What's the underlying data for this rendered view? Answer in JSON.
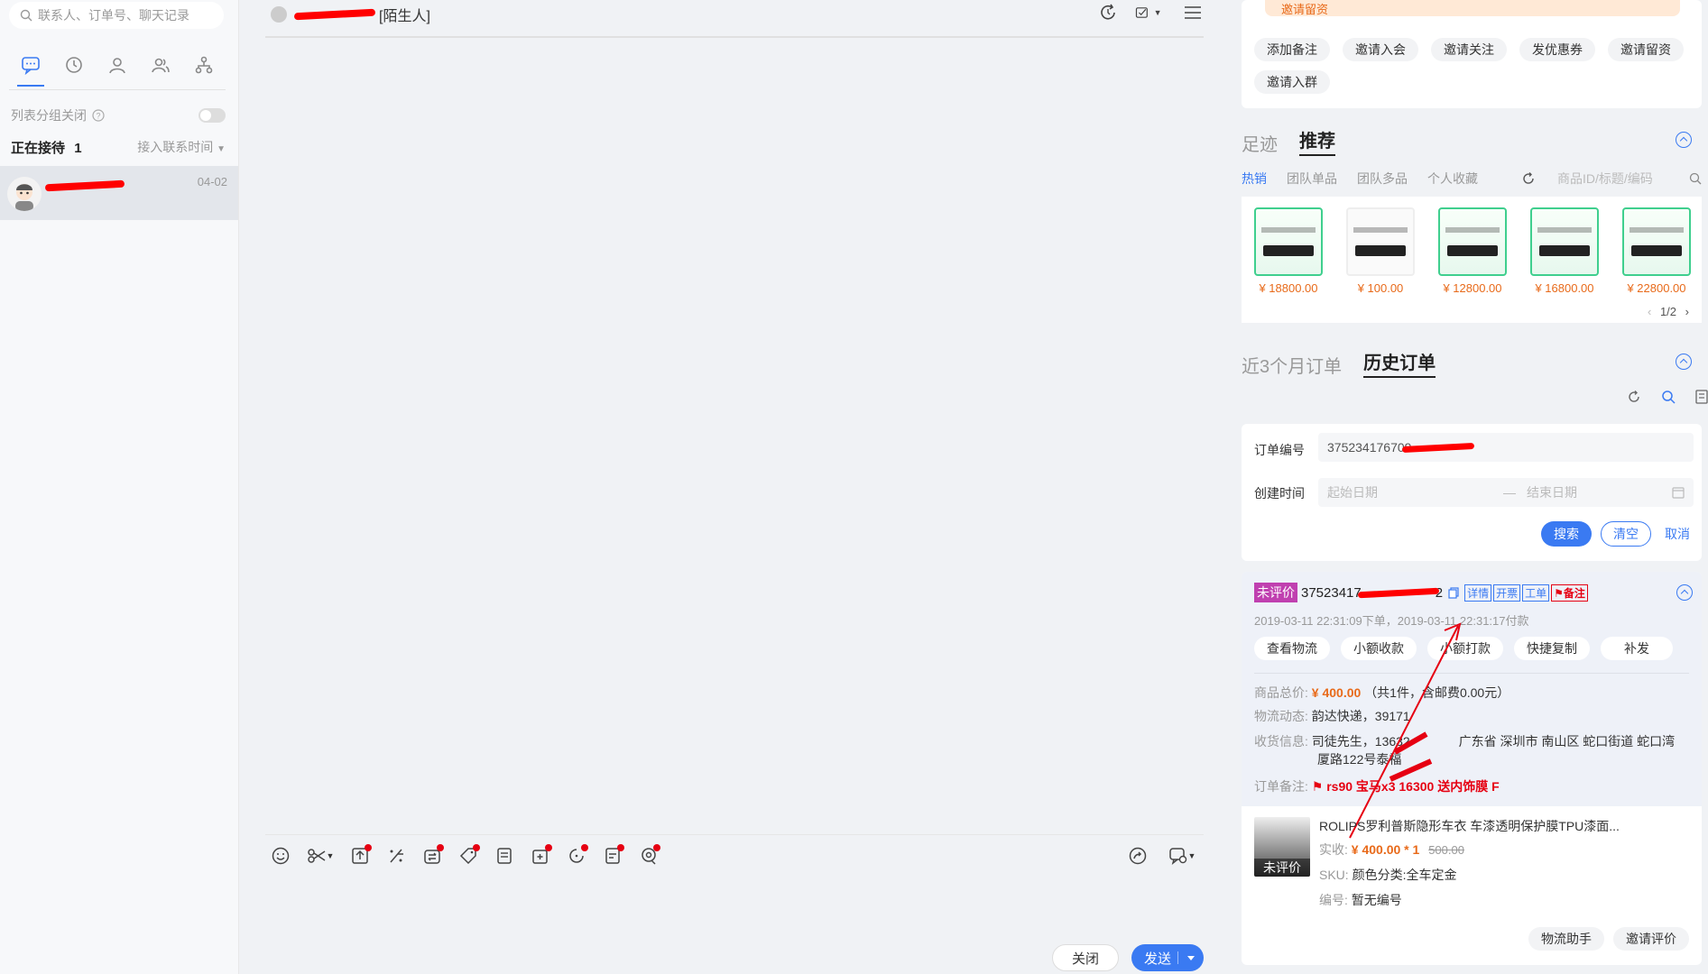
{
  "search": {
    "placeholder": "联系人、订单号、聊天记录"
  },
  "left": {
    "group_toggle_label": "列表分组关闭",
    "receiving_label": "正在接待",
    "receiving_count": "1",
    "sort_label": "接入联系时间",
    "contact": {
      "date": "04-02"
    }
  },
  "chat": {
    "title_suffix": "[陌生人]"
  },
  "footer": {
    "close_label": "关闭",
    "send_label": "发送"
  },
  "right": {
    "banner_text": "邀请留资",
    "chips": [
      "添加备注",
      "邀请入会",
      "邀请关注",
      "发优惠券",
      "邀请留资",
      "邀请入群"
    ],
    "section1_tabs": [
      "足迹",
      "推荐"
    ],
    "subtabs": [
      "热销",
      "团队单品",
      "团队多品",
      "个人收藏"
    ],
    "product_search_placeholder": "商品ID/标题/编码",
    "products": [
      {
        "price": "¥ 18800.00"
      },
      {
        "price": "¥ 100.00"
      },
      {
        "price": "¥ 12800.00"
      },
      {
        "price": "¥ 16800.00"
      },
      {
        "price": "¥ 22800.00"
      }
    ],
    "pager": "1/2",
    "section2_tabs": [
      "近3个月订单",
      "历史订单"
    ],
    "form": {
      "order_no_label": "订单编号",
      "order_no_value": "375234176709",
      "create_time_label": "创建时间",
      "start_placeholder": "起始日期",
      "dash": "—",
      "end_placeholder": "结束日期",
      "search_btn": "搜索",
      "clear_btn": "清空",
      "cancel_btn": "取消"
    },
    "order": {
      "status_tag": "未评价",
      "order_no": "37523417",
      "order_no_tail": "2",
      "tags": [
        "详情",
        "开票",
        "工单"
      ],
      "remark_tag": "备注",
      "times": "2019-03-11 22:31:09下单，2019-03-11 22:31:17付款",
      "actions": [
        "查看物流",
        "小额收款",
        "小额打款",
        "快捷复制",
        "补发"
      ],
      "total_label": "商品总价:",
      "total_value": "¥ 400.00",
      "total_extra": "（共1件，含邮费0.00元）",
      "logistics_label": "物流动态:",
      "logistics_value": "韵达快递，39171",
      "address_label": "收货信息:",
      "address_value": "司徒先生，13632",
      "address_value2": "广东省 深圳市 南山区 蛇口街道 蛇口湾",
      "address_value3": "厦路122号泰福",
      "remark_label": "订单备注:",
      "remark_value": "rs90 宝马x3  16300   送内饰膜  F",
      "item_title": "ROLIPS罗利普斯隐形车衣 车漆透明保护膜TPU漆面...",
      "item_pay_label": "实收:",
      "item_pay_value": "¥ 400.00 * 1",
      "item_original": "500.00",
      "item_sku_label": "SKU:",
      "item_sku_value": "颜色分类:全车定金",
      "item_code_label": "编号:",
      "item_code_value": "暂无编号",
      "item_badge": "未评价",
      "btn_logistics": "物流助手",
      "btn_invite_review": "邀请评价"
    }
  }
}
